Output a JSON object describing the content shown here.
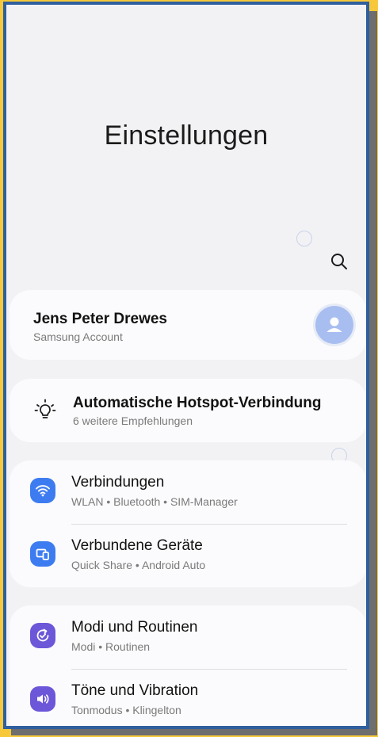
{
  "page": {
    "title": "Einstellungen"
  },
  "account": {
    "name": "Jens Peter Drewes",
    "subtitle": "Samsung Account"
  },
  "suggestion": {
    "title": "Automatische Hotspot-Verbindung",
    "subtitle": "6 weitere Empfehlungen"
  },
  "groups": [
    {
      "items": [
        {
          "label": "Verbindungen",
          "subtitle": "WLAN  •  Bluetooth  •  SIM-Manager",
          "icon": "wifi-icon",
          "color": "#3d7cf0"
        },
        {
          "label": "Verbundene Geräte",
          "subtitle": "Quick Share  •  Android Auto",
          "icon": "connected-devices-icon",
          "color": "#3d7cf0"
        }
      ]
    },
    {
      "items": [
        {
          "label": "Modi und Routinen",
          "subtitle": "Modi  •  Routinen",
          "icon": "modes-routines-icon",
          "color": "#6b57d8"
        },
        {
          "label": "Töne und Vibration",
          "subtitle": "Tonmodus  •  Klingelton",
          "icon": "sound-icon",
          "color": "#6b57d8"
        }
      ]
    }
  ],
  "colors": {
    "frame": "#2f5f9e",
    "background": "#f2f2f5",
    "card": "#fbfbfd",
    "accent_blue": "#3d7cf0",
    "accent_purple": "#6b57d8"
  }
}
